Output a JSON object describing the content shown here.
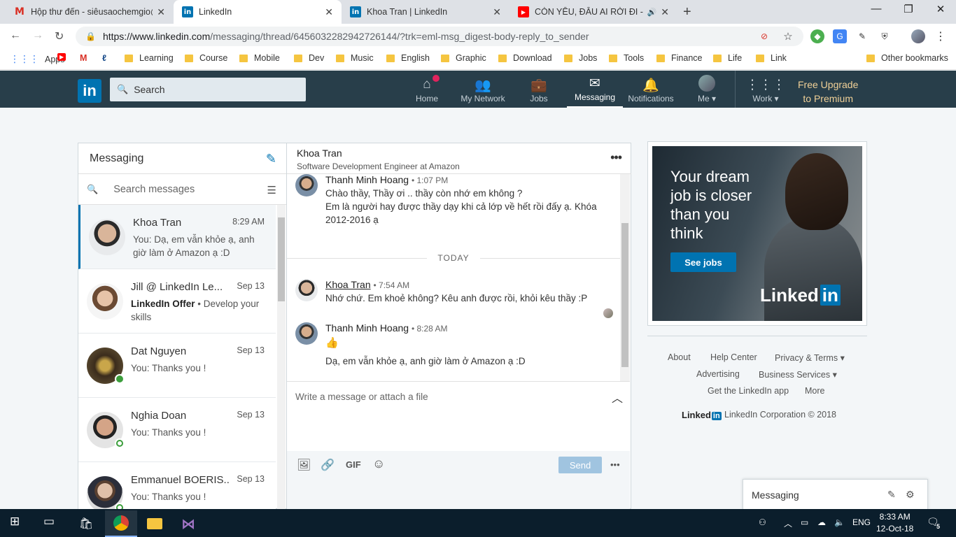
{
  "browser": {
    "tabs": [
      {
        "title": "Hộp thư đến - siêusaochemgio@",
        "icon": "gmail-icon",
        "color": "#d93025"
      },
      {
        "title": "LinkedIn",
        "icon": "linkedin-icon",
        "color": "#0073b1"
      },
      {
        "title": "Khoa Tran | LinkedIn",
        "icon": "linkedin-icon",
        "color": "#0073b1"
      },
      {
        "title": "CÒN YÊU, ĐÂU AI RỜI ĐI - Đ",
        "icon": "youtube-icon",
        "color": "#ff0000"
      }
    ],
    "url_host": "https://www.linkedin.com",
    "url_path": "/messaging/thread/6456032282942726144/?trk=eml-msg_digest-body-reply_to_sender",
    "bookmarks": [
      "Apps",
      "Learning",
      "Course",
      "Mobile",
      "Dev",
      "Music",
      "English",
      "Graphic",
      "Download",
      "Jobs",
      "Tools",
      "Finance",
      "Life",
      "Link",
      "Other bookmarks"
    ]
  },
  "linkedin_nav": {
    "search_placeholder": "Search",
    "items": [
      "Home",
      "My Network",
      "Jobs",
      "Messaging",
      "Notifications",
      "Me",
      "Work"
    ],
    "premium_line1": "Free Upgrade",
    "premium_line2": "to Premium",
    "brand_color": "#0073b1"
  },
  "messaging": {
    "title": "Messaging",
    "search_placeholder": "Search messages",
    "conversations": [
      {
        "name": "Khoa Tran",
        "time": "8:29 AM",
        "preview": "You: Dạ, em vẫn khỏe ạ, anh giờ làm ở Amazon ạ :D"
      },
      {
        "name": "Jill @ LinkedIn Le...",
        "time": "Sep 13",
        "preview_bold": "LinkedIn Offer",
        "preview": "Develop your skills"
      },
      {
        "name": "Dat Nguyen",
        "time": "Sep 13",
        "preview": "You: Thanks you !"
      },
      {
        "name": "Nghia Doan",
        "time": "Sep 13",
        "preview": "You: Thanks you !"
      },
      {
        "name": "Emmanuel BOERIS...",
        "time": "Sep 13",
        "preview": "You: Thanks you !"
      }
    ]
  },
  "thread": {
    "contact_name": "Khoa Tran",
    "contact_title": "Software Development Engineer at Amazon",
    "divider": "TODAY",
    "messages": [
      {
        "sender": "Thanh Minh Hoang",
        "time": "• 1:07 PM",
        "line1": "Chào thầy, Thầy ơi .. thầy còn nhớ em không ?",
        "line2": "Em là người hay được thầy dạy khi cả lớp về hết rồi đấy ạ. Khóa 2012-2016 ạ"
      },
      {
        "sender": "Khoa Tran",
        "time": "• 7:54 AM",
        "line1": "Nhớ chứ. Em khoẻ không? Kêu anh được rồi, khỏi kêu thầy :P"
      },
      {
        "sender": "Thanh Minh Hoang",
        "time": "• 8:28 AM",
        "line1": "👍",
        "line2": "Dạ, em vẫn khỏe ạ, anh giờ làm ở Amazon ạ :D"
      }
    ],
    "compose_placeholder": "Write a message or attach a file",
    "gif_label": "GIF",
    "send_label": "Send"
  },
  "ad": {
    "headline": "Your dream job is closer than you think",
    "button": "See jobs",
    "logo_text": "Linked",
    "logo_in": "in"
  },
  "footer": {
    "links": [
      "About",
      "Help Center",
      "Privacy & Terms",
      "Advertising",
      "Business Services",
      "Get the LinkedIn app",
      "More"
    ],
    "logo_text": "Linked",
    "logo_in": "in",
    "copyright": "LinkedIn Corporation © 2018"
  },
  "mini_messaging": {
    "label": "Messaging"
  },
  "taskbar": {
    "lang": "ENG",
    "time": "8:33 AM",
    "date": "12-Oct-18",
    "notif_count": "5"
  }
}
